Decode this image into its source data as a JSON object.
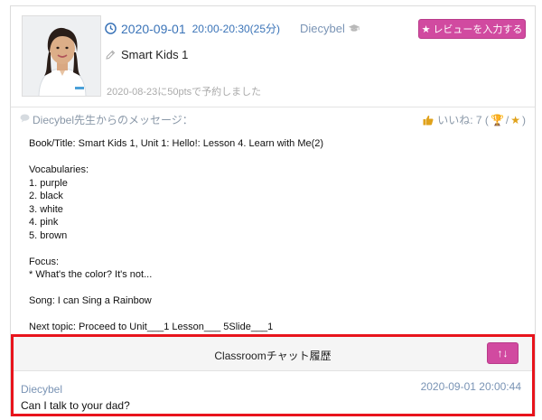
{
  "lesson": {
    "date": "2020-09-01",
    "time_range": "20:00-20:30(25分)",
    "teacher": "Diecybel",
    "review_button": "レビューを入力する",
    "course": "Smart Kids 1",
    "booked_note": "2020-08-23に50ptsで予約しました"
  },
  "message": {
    "from_label": "Diecybel先生からのメッセージ：",
    "likes_label": "いいね: 7 (",
    "likes_sep": "/",
    "likes_close": ")",
    "lines": [
      "Book/Title: Smart Kids 1, Unit 1: Hello!: Lesson 4. Learn with Me(2)",
      "",
      "Vocabularies:",
      "1. purple",
      "2. black",
      "3. white",
      "4. pink",
      "5. brown",
      "",
      "Focus:",
      "* What's the color? It's not...",
      "",
      "Song: I can Sing a Rainbow",
      "",
      "Next topic: Proceed to Unit___1 Lesson___ 5Slide___1"
    ]
  },
  "chat": {
    "title": "Classroomチャット履歴",
    "toggle_label": "↑↓",
    "entries": [
      {
        "sender": "Diecybel",
        "time": "2020-09-01 20:00:44",
        "text": "Can I talk to your dad?"
      }
    ]
  },
  "icons": {
    "clock": "clock-icon",
    "cap": "graduation-cap-icon",
    "star": "star-icon",
    "pencil": "pencil-icon",
    "bubble": "speech-bubble-icon",
    "thumb": "thumbs-up-icon",
    "trophy": "trophy-icon"
  },
  "colors": {
    "accent_pink": "#d14aa0",
    "link_blue": "#3b74b8",
    "highlight_red": "#e8141c"
  }
}
